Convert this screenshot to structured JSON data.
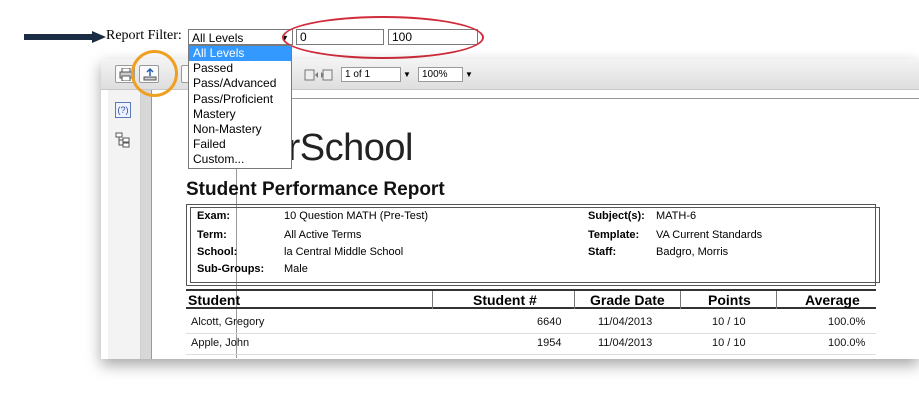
{
  "filter": {
    "label": "Report Filter:",
    "selected": "All Levels",
    "min_value": "0",
    "max_value": "100",
    "options": [
      "All Levels",
      "Passed",
      "Pass/Advanced",
      "Pass/Proficient",
      "Mastery",
      "Non-Mastery",
      "Failed",
      "Custom..."
    ]
  },
  "toolbar": {
    "page_label": "1 of 1",
    "zoom_label": "100%"
  },
  "sidebar": {
    "help_label": "(?)"
  },
  "report": {
    "logo": "PowerSchool",
    "logo_visible": "werSchool",
    "title": "Student Performance Report",
    "info_left": [
      {
        "label": "Exam:",
        "value": "10 Question MATH (Pre-Test)"
      },
      {
        "label": "Term:",
        "value": "All Active Terms"
      },
      {
        "label": "School:",
        "value": "la Central Middle School"
      },
      {
        "label": "Sub-Groups:",
        "value": "Male"
      }
    ],
    "info_right": [
      {
        "label": "Subject(s):",
        "value": "MATH-6"
      },
      {
        "label": "Template:",
        "value": "VA Current Standards"
      },
      {
        "label": "Staff:",
        "value": "Badgro, Morris"
      }
    ],
    "columns": [
      "Student",
      "Student #",
      "Grade Date",
      "Points",
      "Average"
    ],
    "rows": [
      {
        "student": "Alcott, Gregory",
        "number": "6640",
        "date": "11/04/2013",
        "points": "10 / 10",
        "average": "100.0%"
      },
      {
        "student": "Apple, John",
        "number": "1954",
        "date": "11/04/2013",
        "points": "10 / 10",
        "average": "100.0%"
      }
    ]
  },
  "colors": {
    "highlight_red": "#d12c3b",
    "highlight_orange": "#f0a020",
    "selection_blue": "#3399ff",
    "arrow_navy": "#1b2c45"
  }
}
